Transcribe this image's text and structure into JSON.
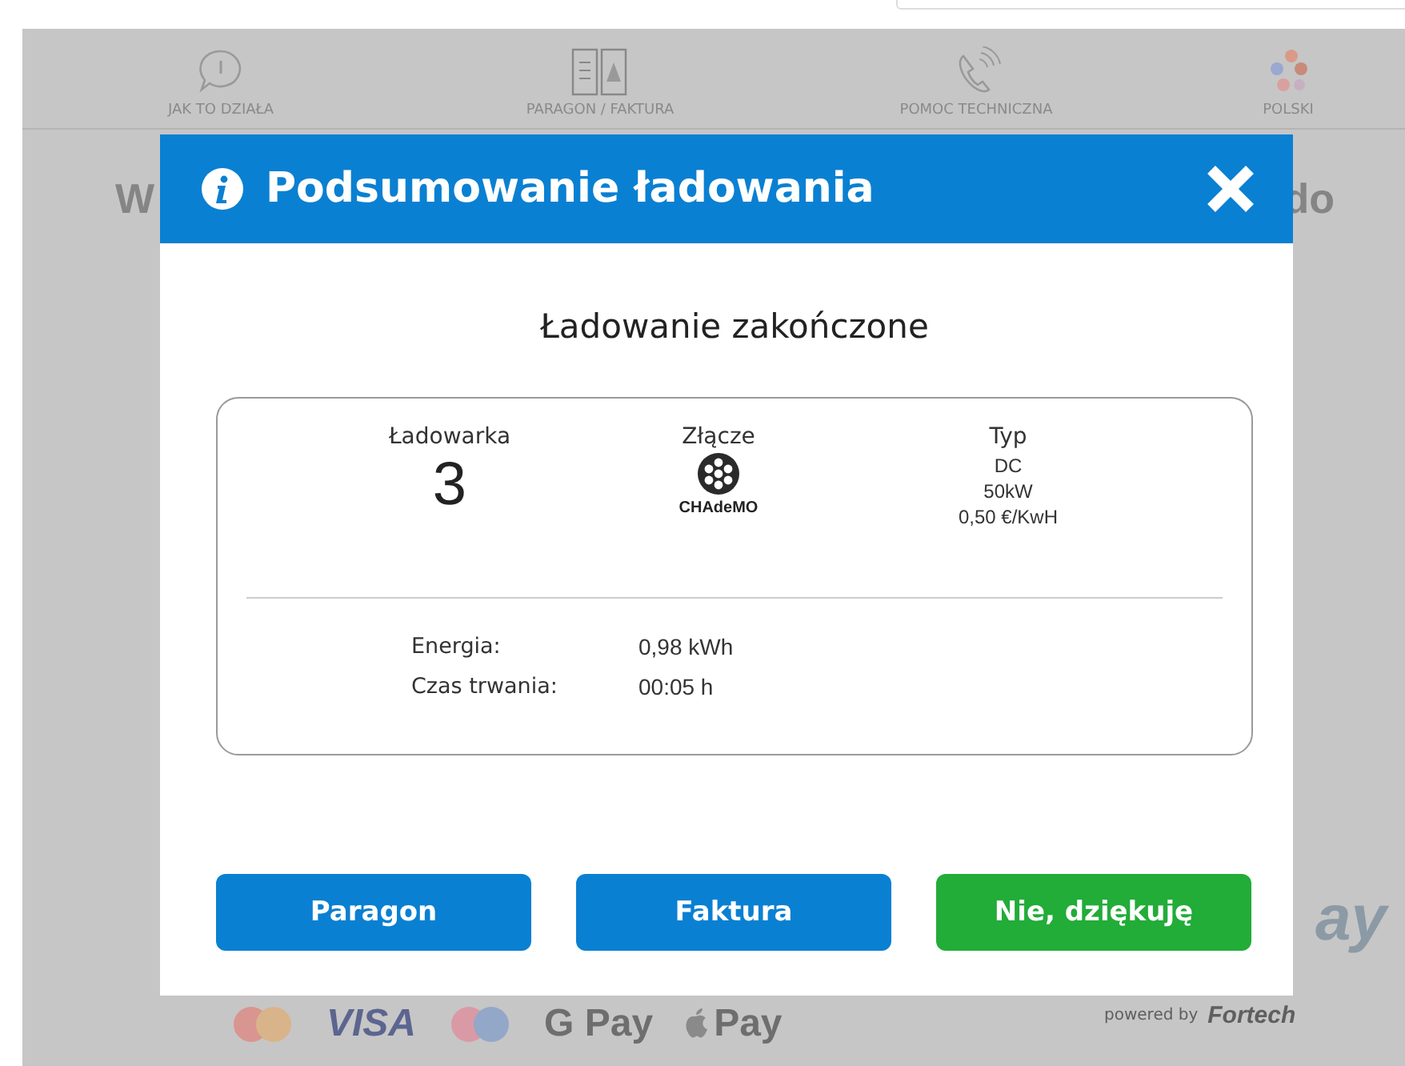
{
  "nav": [
    {
      "kind": "help",
      "label": "JAK TO DZIAŁA"
    },
    {
      "kind": "documents",
      "label": "PARAGON / FAKTURA"
    },
    {
      "kind": "phone",
      "label": "POMOC TECHNICZNA"
    },
    {
      "kind": "flags",
      "label": "POLSKI"
    }
  ],
  "background": {
    "heading_start": "W",
    "heading_end": "do",
    "brand_fragment": "ay",
    "powered_by": "powered by",
    "vendor": "Fortech",
    "payments": [
      {
        "kind": "mastercard"
      },
      {
        "kind": "text",
        "label": "VISA"
      },
      {
        "kind": "maestro"
      },
      {
        "kind": "text",
        "label": "G Pay"
      },
      {
        "kind": "apple",
        "label": "Pay"
      }
    ]
  },
  "dialog": {
    "title": "Podsumowanie ładowania",
    "heading": "Ładowanie zakończone",
    "charger": {
      "label": "Ładowarka",
      "value": "3"
    },
    "connector": {
      "label": "Złącze",
      "name": "CHAdeMO"
    },
    "type": {
      "label": "Typ",
      "lines": [
        "DC",
        "50kW",
        "0,50 €/KwH"
      ]
    },
    "stats": [
      {
        "label": "Energia:",
        "value": "0,98 kWh"
      },
      {
        "label": "Czas trwania:",
        "value": "00:05 h"
      }
    ],
    "buttons": [
      {
        "kind": "primary",
        "label": "Paragon"
      },
      {
        "kind": "primary",
        "label": "Faktura"
      },
      {
        "kind": "confirm",
        "label": "Nie, dziękuję"
      }
    ]
  }
}
